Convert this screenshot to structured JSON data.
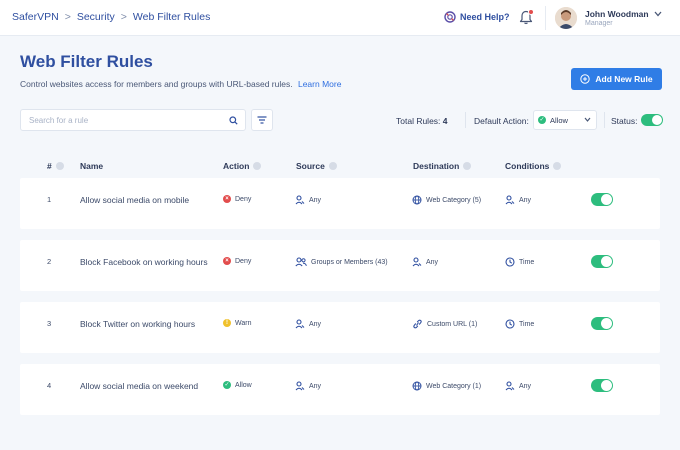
{
  "breadcrumb": [
    "SaferVPN",
    "Security",
    "Web Filter Rules"
  ],
  "topbar": {
    "help_label": "Need Help?",
    "user_name": "John Woodman",
    "user_role": "Manager"
  },
  "page": {
    "title": "Web Filter Rules",
    "description": "Control websites access for members and groups with URL-based rules.",
    "learn_more": "Learn More",
    "add_button": "Add New Rule"
  },
  "toolbar": {
    "search_placeholder": "Search for a rule",
    "total_label": "Total Rules:",
    "total_value": "4",
    "default_action_label": "Default Action:",
    "default_action_value": "Allow",
    "status_label": "Status:",
    "status_on": true
  },
  "table": {
    "columns": [
      "#",
      "Name",
      "Action",
      "Source",
      "Destination",
      "Conditions"
    ],
    "rows": [
      {
        "num": "1",
        "name": "Allow social media on mobile",
        "action": "Deny",
        "action_type": "deny",
        "source": "Any",
        "source_icon": "user-icon",
        "destination": "Web Category (5)",
        "destination_icon": "globe-icon",
        "condition": "Any",
        "condition_icon": "user-icon",
        "enabled": true
      },
      {
        "num": "2",
        "name": "Block Facebook on working hours",
        "action": "Deny",
        "action_type": "deny",
        "source": "Groups or Members (43)",
        "source_icon": "group-icon",
        "destination": "Any",
        "destination_icon": "user-icon",
        "condition": "Time",
        "condition_icon": "clock-icon",
        "enabled": true
      },
      {
        "num": "3",
        "name": "Block Twitter on working hours",
        "action": "Warn",
        "action_type": "warn",
        "source": "Any",
        "source_icon": "user-icon",
        "destination": "Custom URL (1)",
        "destination_icon": "link-icon",
        "condition": "Time",
        "condition_icon": "clock-icon",
        "enabled": true
      },
      {
        "num": "4",
        "name": "Allow social media on weekend",
        "action": "Allow",
        "action_type": "allow",
        "source": "Any",
        "source_icon": "user-icon",
        "destination": "Web Category (1)",
        "destination_icon": "globe-icon",
        "condition": "Any",
        "condition_icon": "user-icon",
        "enabled": true
      }
    ]
  },
  "colors": {
    "brand": "#2f4fa0",
    "primary_button": "#2f7de6",
    "deny": "#e24c4c",
    "warn": "#f0c12c",
    "allow": "#2dbd7e",
    "toggle_on": "#2dbd7e"
  }
}
